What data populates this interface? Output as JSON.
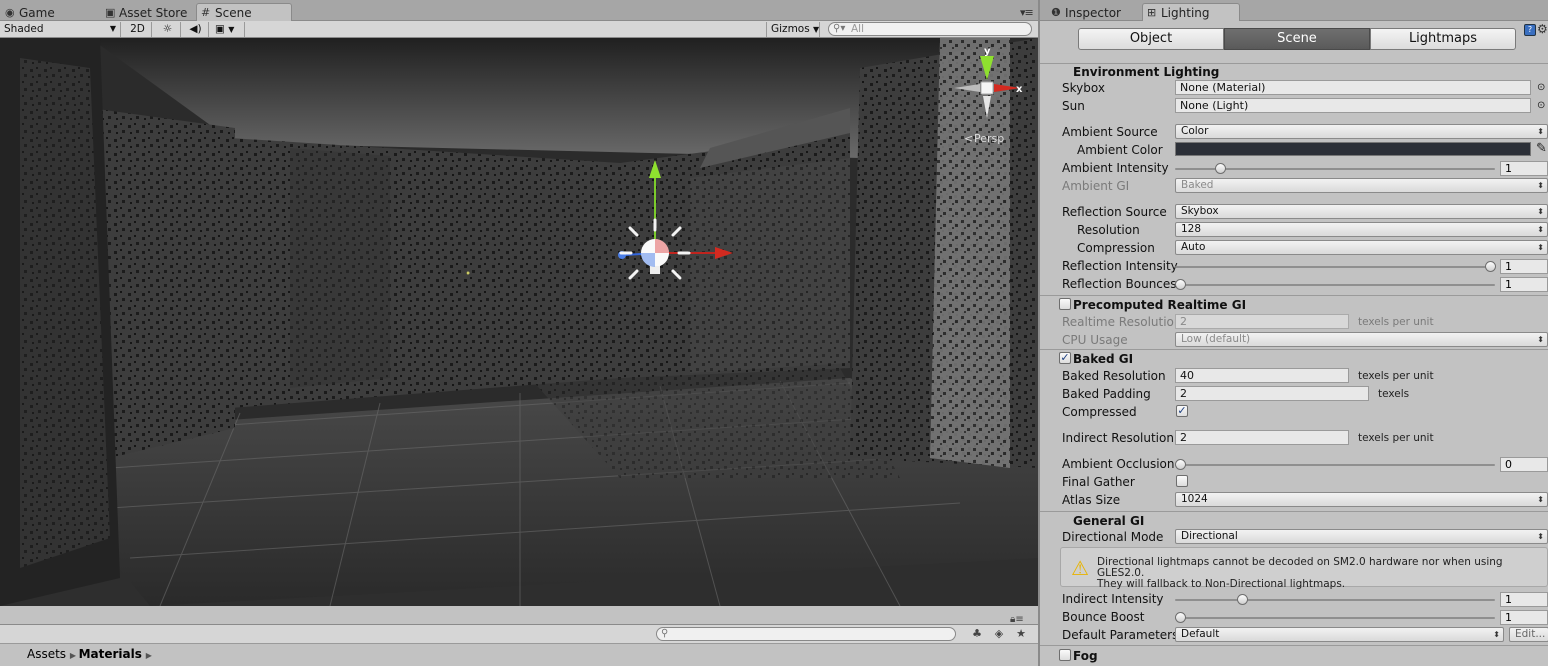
{
  "left_panel": {
    "tabs": [
      {
        "label": "Game",
        "icon": "game-controller-icon"
      },
      {
        "label": "Asset Store",
        "icon": "store-bag-icon"
      },
      {
        "label": "Scene",
        "icon": "grid-icon"
      }
    ],
    "toolbar": {
      "shading_mode": "Shaded",
      "mode_2d": "2D",
      "gizmos": "Gizmos",
      "search_placeholder": "All"
    },
    "gizmo": {
      "y_label": "y",
      "x_label": "x",
      "projection": "Persp"
    },
    "breadcrumb": {
      "root": "Assets",
      "current": "Materials"
    }
  },
  "right_panel": {
    "tabs": [
      {
        "label": "Inspector",
        "icon": "info-icon"
      },
      {
        "label": "Lighting",
        "icon": "lighting-icon"
      }
    ],
    "segments": [
      "Object",
      "Scene",
      "Lightmaps"
    ],
    "active_segment": "Scene",
    "environment": {
      "header": "Environment Lighting",
      "skybox_label": "Skybox",
      "skybox_value": "None (Material)",
      "sun_label": "Sun",
      "sun_value": "None (Light)",
      "ambient_source_label": "Ambient Source",
      "ambient_source_value": "Color",
      "ambient_color_label": "Ambient Color",
      "ambient_color_hex": "#2c3038",
      "ambient_intensity_label": "Ambient Intensity",
      "ambient_intensity_value": "1",
      "ambient_intensity_fraction": 0.13,
      "ambient_gi_label": "Ambient GI",
      "ambient_gi_value": "Baked",
      "reflection_source_label": "Reflection Source",
      "reflection_source_value": "Skybox",
      "resolution_label": "Resolution",
      "resolution_value": "128",
      "compression_label": "Compression",
      "compression_value": "Auto",
      "reflection_intensity_label": "Reflection Intensity",
      "reflection_intensity_value": "1",
      "reflection_intensity_fraction": 1.0,
      "reflection_bounces_label": "Reflection Bounces",
      "reflection_bounces_value": "1",
      "reflection_bounces_fraction": 0.0
    },
    "realtime_gi": {
      "header": "Precomputed Realtime GI",
      "enabled": false,
      "resolution_label": "Realtime Resolution",
      "resolution_value": "2",
      "resolution_unit": "texels per unit",
      "cpu_label": "CPU Usage",
      "cpu_value": "Low (default)"
    },
    "baked_gi": {
      "header": "Baked GI",
      "enabled": true,
      "check_mark": "✓",
      "baked_resolution_label": "Baked Resolution",
      "baked_resolution_value": "40",
      "baked_resolution_unit": "texels per unit",
      "baked_padding_label": "Baked Padding",
      "baked_padding_value": "2",
      "baked_padding_unit": "texels",
      "compressed_label": "Compressed",
      "compressed": true,
      "indirect_resolution_label": "Indirect Resolution",
      "indirect_resolution_value": "2",
      "indirect_resolution_unit": "texels per unit",
      "ambient_occlusion_label": "Ambient Occlusion",
      "ambient_occlusion_value": "0",
      "ambient_occlusion_fraction": 0.0,
      "final_gather_label": "Final Gather",
      "final_gather": false,
      "atlas_size_label": "Atlas Size",
      "atlas_size_value": "1024"
    },
    "general_gi": {
      "header": "General GI",
      "directional_mode_label": "Directional Mode",
      "directional_mode_value": "Directional",
      "warning_line1": "Directional lightmaps cannot be decoded on SM2.0 hardware nor when using GLES2.0.",
      "warning_line2": "They will fallback to Non-Directional lightmaps.",
      "indirect_intensity_label": "Indirect Intensity",
      "indirect_intensity_value": "1",
      "indirect_intensity_fraction": 0.2,
      "bounce_boost_label": "Bounce Boost",
      "bounce_boost_value": "1",
      "bounce_boost_fraction": 0.0,
      "default_parameters_label": "Default Parameters",
      "default_parameters_value": "Default",
      "edit_label": "Edit..."
    },
    "fog": {
      "header": "Fog",
      "enabled": false
    }
  }
}
